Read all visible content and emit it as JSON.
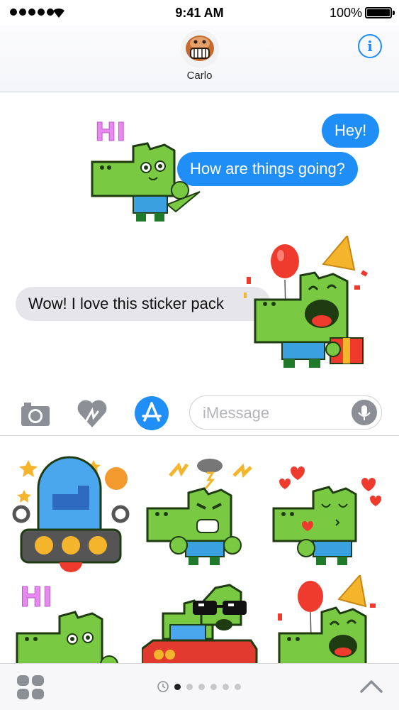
{
  "status_bar": {
    "time": "9:41 AM",
    "battery": "100%"
  },
  "header": {
    "contact_name": "Carlo",
    "info_icon": "i"
  },
  "conversation": {
    "messages": [
      {
        "direction": "outgoing",
        "text": "Hey!"
      },
      {
        "direction": "outgoing",
        "text": "How are things going?"
      },
      {
        "direction": "incoming",
        "text": "Wow! I love this sticker pack"
      }
    ],
    "stickers": [
      {
        "name": "hi-croc-sticker",
        "caption": "HI"
      },
      {
        "name": "party-croc-sticker",
        "caption": ""
      }
    ]
  },
  "input_bar": {
    "placeholder": "iMessage",
    "tools": [
      "camera-icon",
      "digital-touch-icon",
      "app-store-icon"
    ]
  },
  "drawer": {
    "stickers": [
      {
        "name": "ufo-croc",
        "caption": ""
      },
      {
        "name": "angry-croc",
        "caption": ""
      },
      {
        "name": "kissing-croc",
        "caption": ""
      },
      {
        "name": "hi-croc",
        "caption": "HI"
      },
      {
        "name": "cool-car-croc",
        "caption": ""
      },
      {
        "name": "party-croc",
        "caption": ""
      }
    ]
  },
  "bottom_bar": {
    "pages": 6,
    "active_page": 1
  },
  "colors": {
    "imessage_blue": "#1f8ef6",
    "incoming_gray": "#e6e6ea",
    "croc_green": "#7ac943",
    "croc_dark": "#1f3b12",
    "shirt_blue": "#3aa0e0",
    "balloon_red": "#ef3b2d",
    "hi_pink": "#e988f0"
  }
}
